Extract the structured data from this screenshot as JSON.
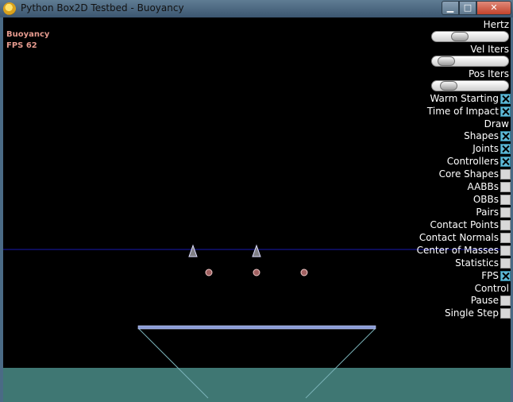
{
  "window": {
    "title": "Python Box2D Testbed - Buoyancy",
    "minimize_icon": "minimize-icon",
    "maximize_icon": "maximize-icon",
    "close_icon": "close-icon",
    "min_label": "▁",
    "max_label": "□",
    "close_label": "✕"
  },
  "info": {
    "test_name": "Buoyancy",
    "fps": "FPS 62"
  },
  "colors": {
    "water": "#3f7773",
    "surface_line": "#1a1ab0",
    "info_text": "#e59a8e",
    "checkbox_on": "#5fb9d6"
  },
  "panel": {
    "hertz": {
      "label": "Hertz",
      "value": 0.33
    },
    "vel_iters": {
      "label": "Vel Iters",
      "value": 0.1
    },
    "pos_iters": {
      "label": "Pos Iters",
      "value": 0.14
    },
    "warm_starting": {
      "label": "Warm Starting",
      "checked": true
    },
    "time_of_impact": {
      "label": "Time of Impact",
      "checked": true
    },
    "draw_header": "Draw",
    "shapes": {
      "label": "Shapes",
      "checked": true
    },
    "joints": {
      "label": "Joints",
      "checked": true
    },
    "controllers": {
      "label": "Controllers",
      "checked": true
    },
    "core_shapes": {
      "label": "Core Shapes",
      "checked": false
    },
    "aabbs": {
      "label": "AABBs",
      "checked": false
    },
    "obbs": {
      "label": "OBBs",
      "checked": false
    },
    "pairs": {
      "label": "Pairs",
      "checked": false
    },
    "contact_points": {
      "label": "Contact Points",
      "checked": false
    },
    "contact_normals": {
      "label": "Contact Normals",
      "checked": false
    },
    "center_of_masses": {
      "label": "Center of Masses",
      "checked": false
    },
    "statistics": {
      "label": "Statistics",
      "checked": false
    },
    "fps": {
      "label": "FPS",
      "checked": true
    },
    "control_header": "Control",
    "pause": {
      "label": "Pause",
      "checked": false
    },
    "single_step": {
      "label": "Single Step",
      "checked": false
    }
  }
}
